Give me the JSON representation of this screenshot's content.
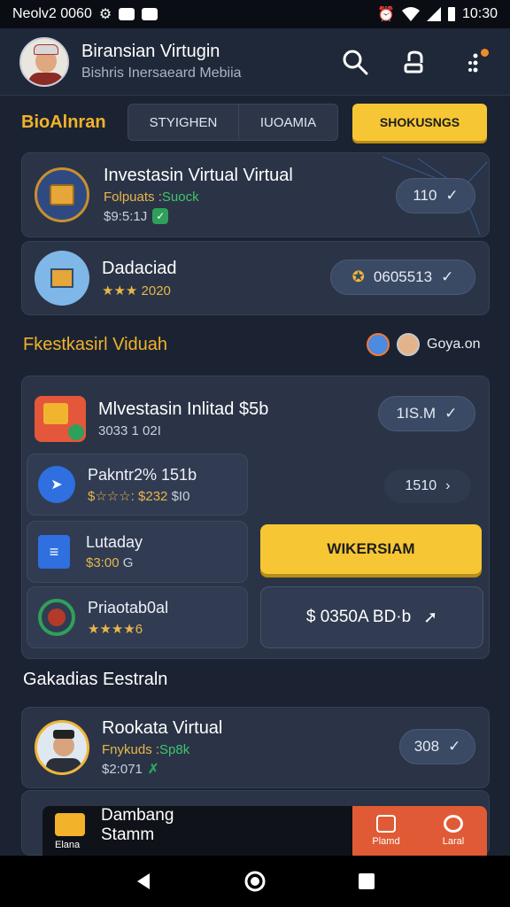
{
  "status_bar": {
    "carrier": "Neolv2 0060",
    "time": "10:30"
  },
  "header": {
    "title": "Biransian Virtugin",
    "subtitle": "Bishris Inersaeard Mebiia"
  },
  "tabs_row": {
    "label": "BioAlnran",
    "tabs": [
      "STYIGHEN",
      "IUOAMIA"
    ],
    "action": "SHOKUSNGS"
  },
  "top_items": [
    {
      "title": "Investasin Virtual Virtual",
      "tag": "Folpuats :",
      "tag2": "Suock",
      "price": "$9:5:1J",
      "pill": "110"
    },
    {
      "title": "Dadaciad",
      "rating": "★★★ 2020",
      "pill": "0605513"
    }
  ],
  "section2": {
    "title": "Fkestkasirl Viduah",
    "people": "Goya.on"
  },
  "main_card": {
    "title": "Mlvestasin Inlitad $5b",
    "sub": "3033 1 02I",
    "pill": "1IS.M"
  },
  "list_items": [
    {
      "title": "Pakntr2% 151b",
      "sub": "$☆☆☆: $232",
      "sub2": "$I0"
    },
    {
      "title": "Lutaday",
      "sub": "$3:00",
      "sub2": "G"
    },
    {
      "title": "Priaotab0al",
      "sub": "★★★★6"
    }
  ],
  "right_col": {
    "pill": "1510",
    "cta": "WIKERSIAM",
    "amount": "$ 0350A BD·b"
  },
  "section3": {
    "title": "Gakadias Eestraln"
  },
  "bottom_item": {
    "title": "Rookata Virtual",
    "tag": "Fnykuds :",
    "tag2": "Sp8k",
    "price": "$2:071",
    "pill": "308"
  },
  "bottom_sheet": {
    "title": "Dambang",
    "sub": "Stamm",
    "left_label": "Elana",
    "tab1": "Plamd",
    "tab2": "Laral"
  },
  "colors": {
    "accent": "#f6c634",
    "background": "#1b2332",
    "card": "#2a3446",
    "orange": "#e05b35"
  }
}
